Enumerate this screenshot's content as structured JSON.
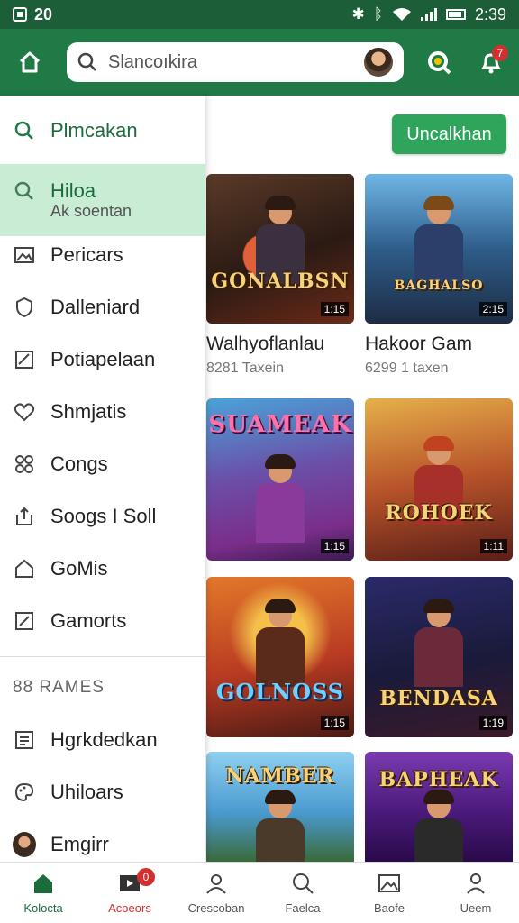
{
  "status_bar": {
    "left_text": "20",
    "time": "2:39"
  },
  "search": {
    "placeholder": "Slancoıkira"
  },
  "header": {
    "notification_count": "7"
  },
  "drawer": {
    "top_item": "Plmcakan",
    "active_item": {
      "label": "Hiloa",
      "sub": "Ak soentan"
    },
    "items": [
      "Pericars",
      "Dalleniard",
      "Potiapelaan",
      "Shmjatis",
      "Congs",
      "Soogs I Soll",
      "GoMis",
      "Gamorts"
    ],
    "section_header": "88 RAMES",
    "section_items": [
      "Hgrkdedkan",
      "Uhiloars",
      "Emgirr"
    ]
  },
  "main": {
    "action_button": "Uncalkhan",
    "cards": [
      {
        "title_art": "GONALBSN",
        "duration": "1:15",
        "label": "Walhyoflanlau",
        "sub": "8281 Taxein"
      },
      {
        "title_art": "BAGHALSO",
        "duration": "2:15",
        "label": "Hakoor Gam",
        "sub": "6299 1 taxen"
      },
      {
        "title_art": "SUAMEAK",
        "duration": "1:15",
        "label": "",
        "sub": ""
      },
      {
        "title_art": "ROHOEK",
        "duration": "1:11",
        "label": "",
        "sub": ""
      },
      {
        "title_art": "GOLNOSS",
        "duration": "1:15",
        "label": "",
        "sub": ""
      },
      {
        "title_art": "BENDASA",
        "duration": "1:19",
        "label": "",
        "sub": ""
      },
      {
        "title_art": "NAMBER",
        "duration": "",
        "label": "",
        "sub": ""
      },
      {
        "title_art": "BAPHEAK",
        "duration": "",
        "label": "",
        "sub": ""
      }
    ]
  },
  "bottom_nav": {
    "items": [
      "Kolocta",
      "Acoeors",
      "Crescoban",
      "Faelca",
      "Baofe",
      "Ueem"
    ],
    "badge": "0"
  },
  "colors": {
    "primary": "#1f7a45",
    "status": "#1b5e37",
    "accent": "#2ea55a",
    "drawer_active": "#c8ecd4",
    "badge": "#d32f2f"
  }
}
